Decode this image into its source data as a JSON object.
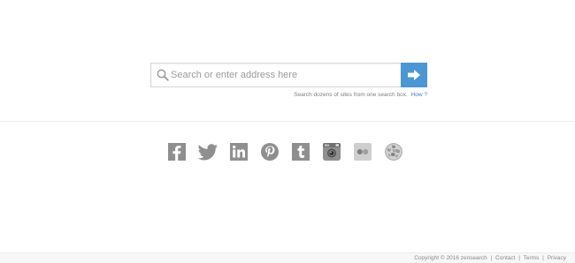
{
  "search": {
    "placeholder": "Search or enter address here",
    "value": ""
  },
  "hint": {
    "text": "Search dozens of sites from one search box.",
    "link_label": "How ?"
  },
  "social": [
    {
      "name": "facebook",
      "icon": "facebook-icon"
    },
    {
      "name": "twitter",
      "icon": "twitter-icon"
    },
    {
      "name": "linkedin",
      "icon": "linkedin-icon"
    },
    {
      "name": "pinterest",
      "icon": "pinterest-icon"
    },
    {
      "name": "tumblr",
      "icon": "tumblr-icon"
    },
    {
      "name": "instagram",
      "icon": "instagram-icon"
    },
    {
      "name": "flickr",
      "icon": "flickr-icon"
    },
    {
      "name": "wikipedia",
      "icon": "wikipedia-icon"
    }
  ],
  "footer": {
    "copyright": "Copyright © 2016 zensearch",
    "contact": "Contact",
    "terms": "Terms",
    "privacy": "Privacy",
    "separator": "|"
  },
  "colors": {
    "accent": "#4a97d3",
    "icon_gray": "#8f8f8f"
  }
}
